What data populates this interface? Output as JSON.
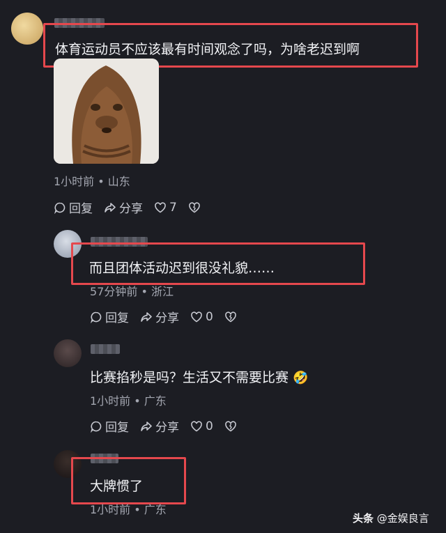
{
  "comments": [
    {
      "text": "体育运动员不应该最有时间观念了吗，为啥老迟到啊",
      "meta": "1小时前 • 山东",
      "actions": {
        "reply": "回复",
        "share": "分享",
        "likes": "7"
      }
    },
    {
      "text": "而且团体活动迟到很没礼貌……",
      "meta": "57分钟前 • 浙江",
      "actions": {
        "reply": "回复",
        "share": "分享",
        "likes": "0"
      }
    },
    {
      "text": "比赛掐秒是吗？生活又不需要比赛",
      "emoji": "🤣",
      "meta": "1小时前 • 广东",
      "actions": {
        "reply": "回复",
        "share": "分享",
        "likes": "0"
      }
    },
    {
      "text": "大牌惯了",
      "meta": "1小时前 • 广东"
    }
  ],
  "watermark": {
    "brand": "头条",
    "account": "@金娱良言"
  },
  "colors": {
    "background": "#1c1d23",
    "highlight": "#e5484d"
  }
}
